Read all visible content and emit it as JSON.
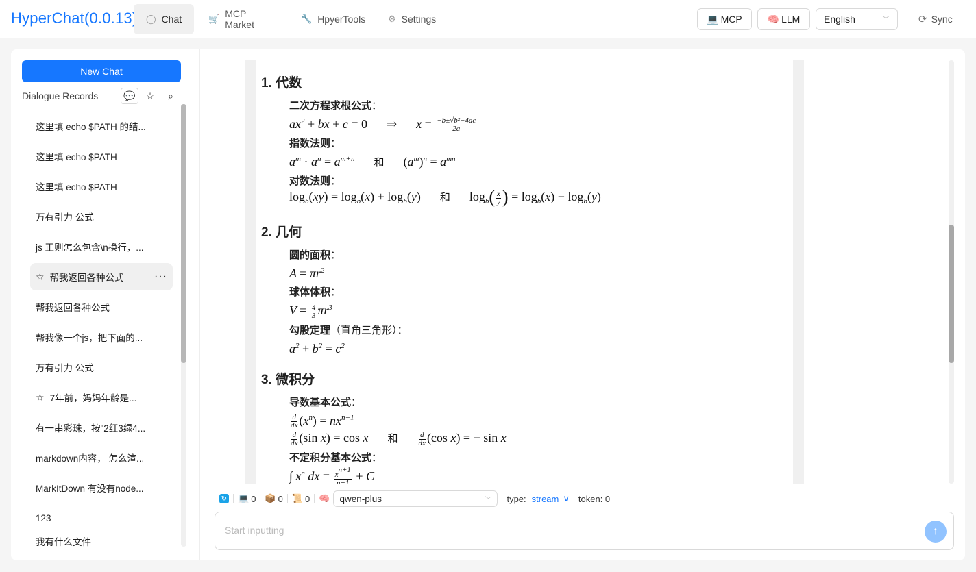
{
  "app": {
    "title": "HyperChat(0.0.13)"
  },
  "nav": {
    "chat": "Chat",
    "mcp_market": "MCP Market",
    "hyper_tools": "HpyerTools",
    "settings": "Settings"
  },
  "header": {
    "mcp_label": "MCP",
    "llm_label": "LLM",
    "language": "English",
    "sync_label": "Sync"
  },
  "sidebar": {
    "new_chat": "New Chat",
    "records_title": "Dialogue Records",
    "items": [
      {
        "label": "这里填 echo $PATH 的结...",
        "starred": false
      },
      {
        "label": "这里填 echo $PATH",
        "starred": false
      },
      {
        "label": "这里填 echo $PATH",
        "starred": false
      },
      {
        "label": "万有引力 公式",
        "starred": false
      },
      {
        "label": "js 正则怎么包含\\n换行，...",
        "starred": false
      },
      {
        "label": "帮我返回各种公式",
        "starred": true,
        "active": true
      },
      {
        "label": "帮我返回各种公式",
        "starred": false
      },
      {
        "label": "帮我像一个js，把下面的...",
        "starred": false
      },
      {
        "label": "万有引力 公式",
        "starred": false
      },
      {
        "label": "7年前，妈妈年龄是...",
        "starred": true
      },
      {
        "label": "有一串彩珠，按\"2红3绿4...",
        "starred": false
      },
      {
        "label": "markdown内容， 怎么渲...",
        "starred": false
      },
      {
        "label": "MarkItDown 有没有node...",
        "starred": false
      },
      {
        "label": "123",
        "starred": false
      },
      {
        "label": "我有什么文件",
        "starred": false
      }
    ]
  },
  "content": {
    "sections": [
      {
        "heading": "1. 代数",
        "labels": [
          "二次方程求根公式",
          "指数法则",
          "对数法则"
        ]
      },
      {
        "heading": "2. 几何",
        "labels": [
          "圆的面积",
          "球体体积",
          "勾股定理",
          "（直角三角形）"
        ]
      },
      {
        "heading": "3. 微积分",
        "labels": [
          "导数基本公式",
          "不定积分基本公式"
        ]
      }
    ],
    "connector": "和",
    "colon": "："
  },
  "toolbar": {
    "mcp_count": "0",
    "box_count": "0",
    "scroll_count": "0",
    "model": "qwen-plus",
    "type_label": "type:",
    "type_value": "stream",
    "token_label": "token: 0"
  },
  "input": {
    "placeholder": "Start inputting"
  }
}
